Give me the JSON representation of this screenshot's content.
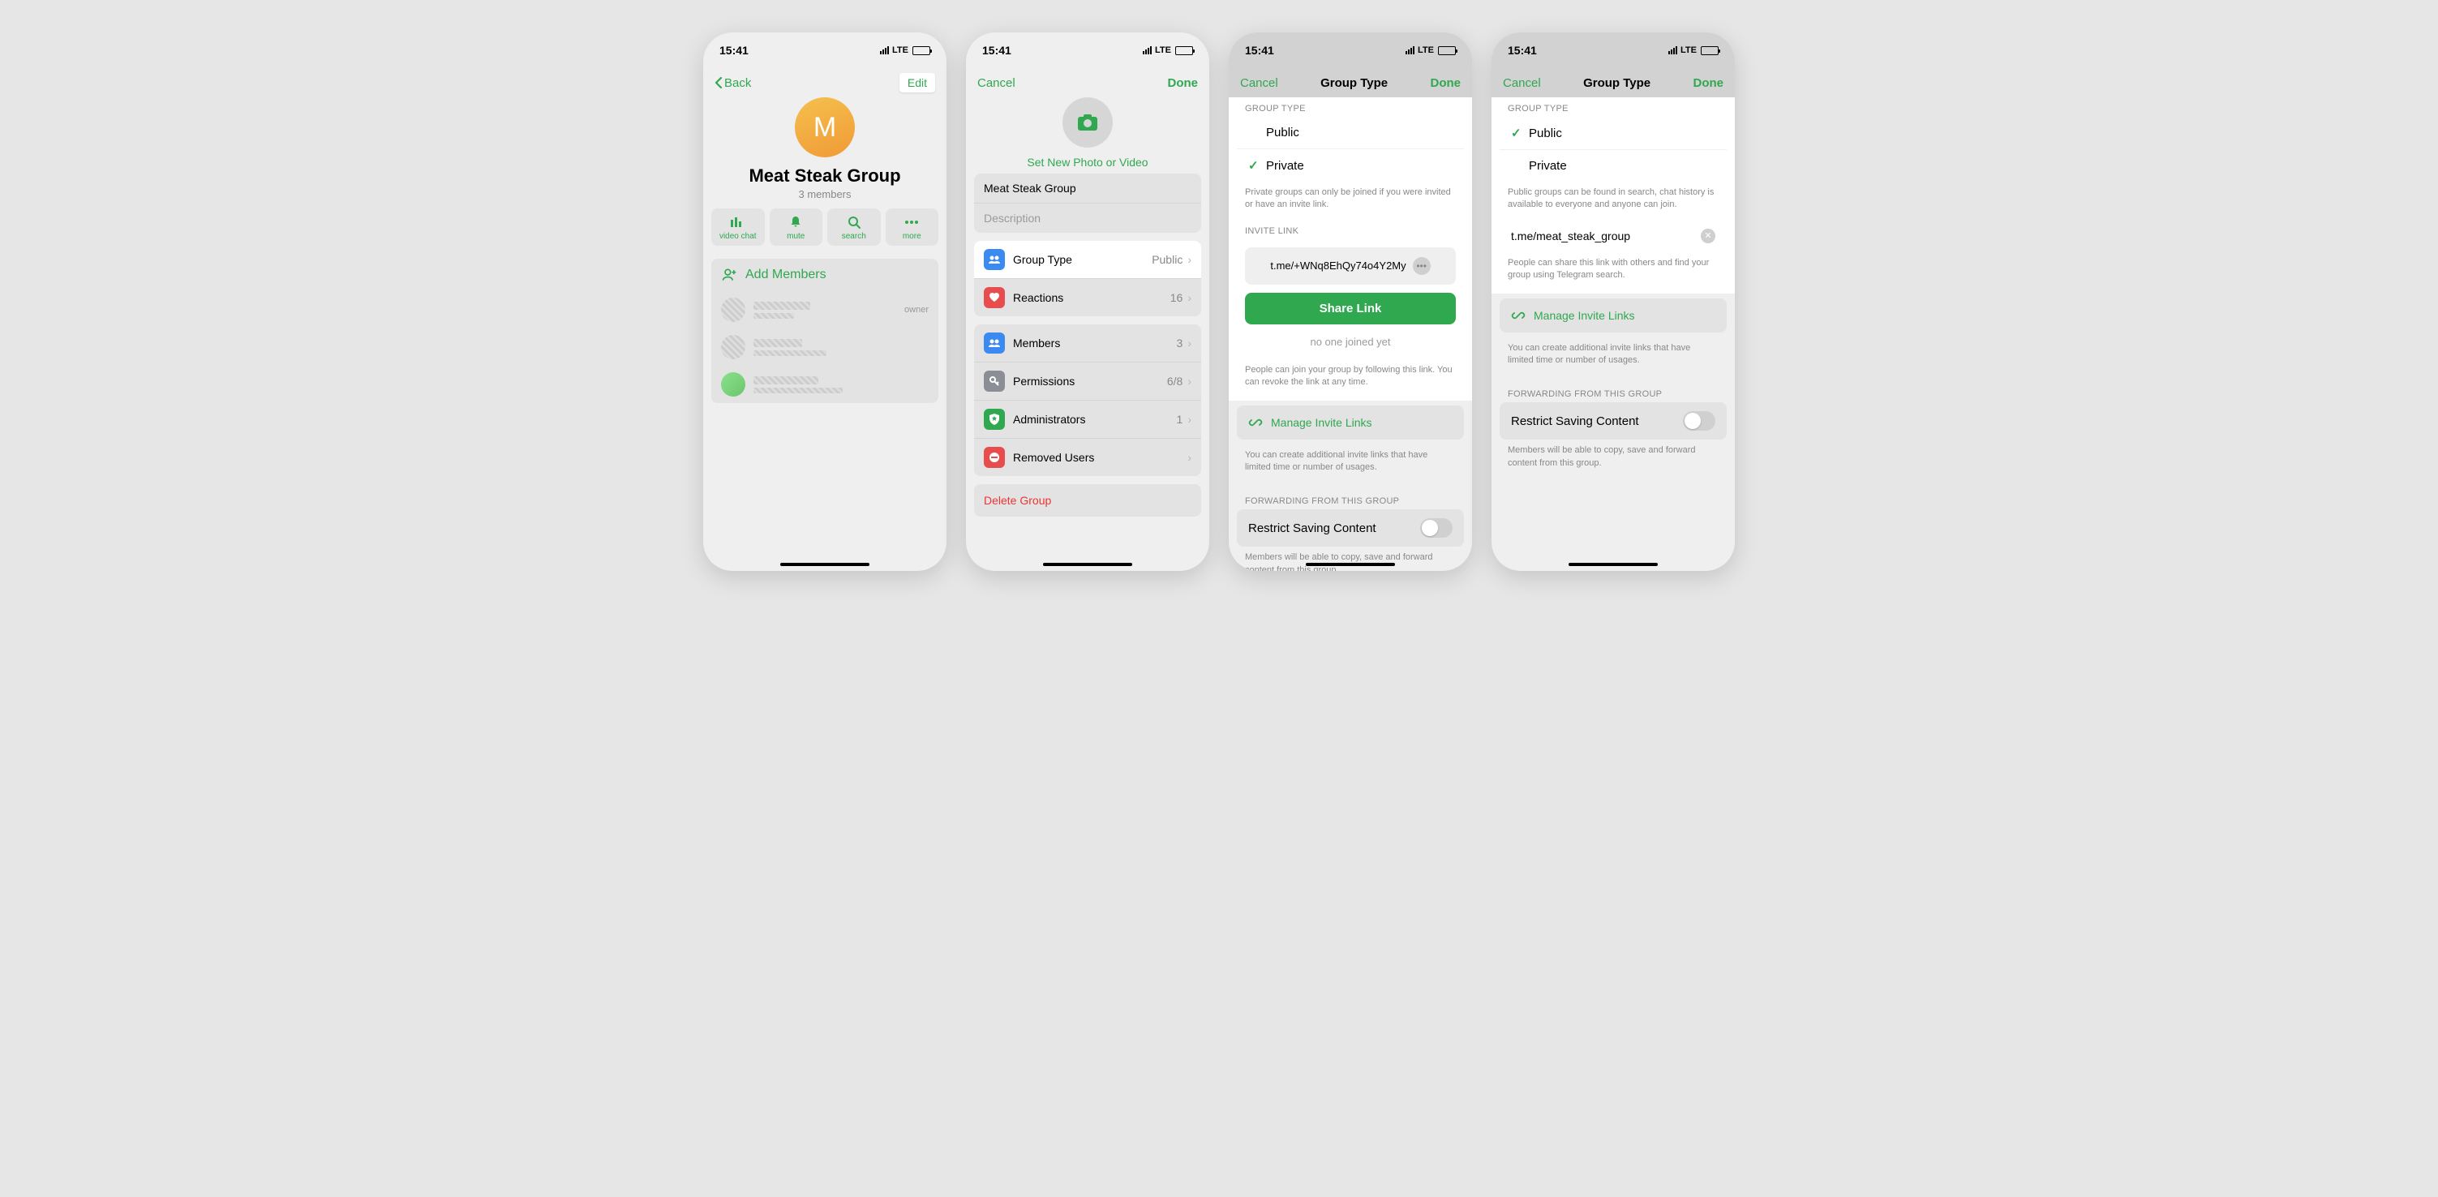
{
  "status": {
    "time": "15:41",
    "network": "LTE"
  },
  "screen1": {
    "back": "Back",
    "edit": "Edit",
    "avatar_letter": "M",
    "title": "Meat Steak Group",
    "subtitle": "3 members",
    "actions": {
      "video": "video chat",
      "mute": "mute",
      "search": "search",
      "more": "more"
    },
    "add_members": "Add Members",
    "owner_tag": "owner"
  },
  "screen2": {
    "cancel": "Cancel",
    "done": "Done",
    "set_photo": "Set New Photo or Video",
    "name_value": "Meat Steak Group",
    "desc_placeholder": "Description",
    "group_type": {
      "label": "Group Type",
      "value": "Public"
    },
    "reactions": {
      "label": "Reactions",
      "value": "16"
    },
    "members": {
      "label": "Members",
      "value": "3"
    },
    "permissions": {
      "label": "Permissions",
      "value": "6/8"
    },
    "admins": {
      "label": "Administrators",
      "value": "1"
    },
    "removed": {
      "label": "Removed Users"
    },
    "delete": "Delete Group"
  },
  "screen3": {
    "cancel": "Cancel",
    "title": "Group Type",
    "done": "Done",
    "header_type": "GROUP TYPE",
    "public": "Public",
    "private": "Private",
    "type_footer": "Private groups can only be joined if you were invited or have an invite link.",
    "header_link": "INVITE LINK",
    "link": "t.me/+WNq8EhQy74o4Y2My",
    "share": "Share Link",
    "noone": "no one joined yet",
    "link_footer": "People can join your group by following this link. You can revoke the link at any time.",
    "manage": "Manage Invite Links",
    "manage_footer": "You can create additional invite links that have limited time or number of usages.",
    "header_fwd": "FORWARDING FROM THIS GROUP",
    "restrict": "Restrict Saving Content",
    "restrict_footer": "Members will be able to copy, save and forward content from this group."
  },
  "screen4": {
    "cancel": "Cancel",
    "title": "Group Type",
    "done": "Done",
    "header_type": "GROUP TYPE",
    "public": "Public",
    "private": "Private",
    "type_footer": "Public groups can be found in search, chat history is available to everyone and anyone can join.",
    "link": "t.me/meat_steak_group",
    "link_footer": "People can share this link with others and find your group using Telegram search.",
    "manage": "Manage Invite Links",
    "manage_footer": "You can create additional invite links that have limited time or number of usages.",
    "header_fwd": "FORWARDING FROM THIS GROUP",
    "restrict": "Restrict Saving Content",
    "restrict_footer": "Members will be able to copy, save and forward content from this group."
  }
}
